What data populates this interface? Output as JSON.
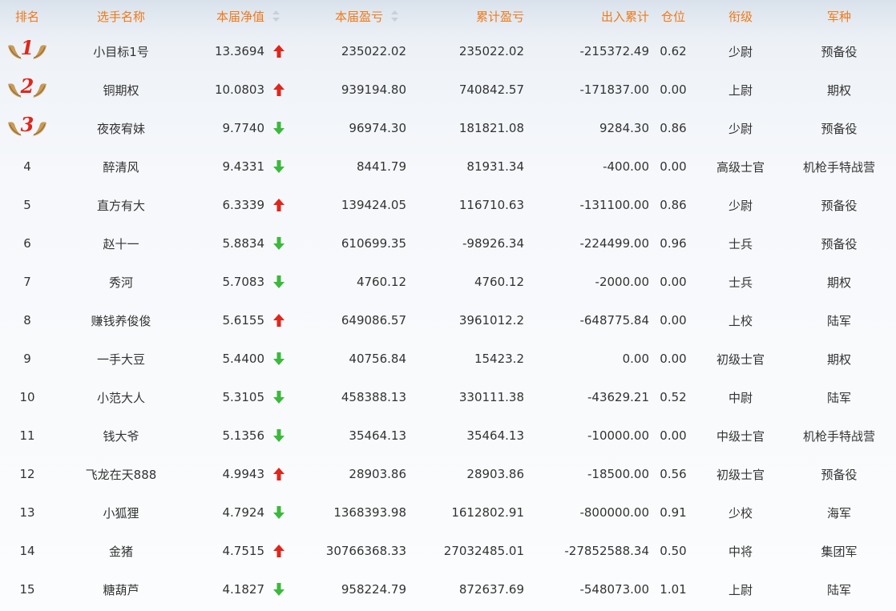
{
  "headers": {
    "rank": "排名",
    "name": "选手名称",
    "net_value": "本届净值",
    "period_pnl": "本届盈亏",
    "cumulative_pnl": "累计盈亏",
    "cash_flow": "出入累计",
    "position": "仓位",
    "military_rank": "衔级",
    "branch": "军种"
  },
  "colors": {
    "header_text": "#ee7a1a",
    "up": "#e0261b",
    "down": "#3cb93c",
    "medal_number": "#e0261b"
  },
  "rows": [
    {
      "rank": "1",
      "medal": true,
      "name": "小目标1号",
      "net_value": "13.3694",
      "trend": "up",
      "period_pnl": "235022.02",
      "cumulative_pnl": "235022.02",
      "cash_flow": "-215372.49",
      "position": "0.62",
      "military_rank": "少尉",
      "branch": "预备役"
    },
    {
      "rank": "2",
      "medal": true,
      "name": "铜期权",
      "net_value": "10.0803",
      "trend": "up",
      "period_pnl": "939194.80",
      "cumulative_pnl": "740842.57",
      "cash_flow": "-171837.00",
      "position": "0.00",
      "military_rank": "上尉",
      "branch": "期权"
    },
    {
      "rank": "3",
      "medal": true,
      "name": "夜夜宥妹",
      "net_value": "9.7740",
      "trend": "down",
      "period_pnl": "96974.30",
      "cumulative_pnl": "181821.08",
      "cash_flow": "9284.30",
      "position": "0.86",
      "military_rank": "少尉",
      "branch": "预备役"
    },
    {
      "rank": "4",
      "medal": false,
      "name": "醉清风",
      "net_value": "9.4331",
      "trend": "down",
      "period_pnl": "8441.79",
      "cumulative_pnl": "81931.34",
      "cash_flow": "-400.00",
      "position": "0.00",
      "military_rank": "高级士官",
      "branch": "机枪手特战营"
    },
    {
      "rank": "5",
      "medal": false,
      "name": "直方有大",
      "net_value": "6.3339",
      "trend": "up",
      "period_pnl": "139424.05",
      "cumulative_pnl": "116710.63",
      "cash_flow": "-131100.00",
      "position": "0.86",
      "military_rank": "少尉",
      "branch": "预备役"
    },
    {
      "rank": "6",
      "medal": false,
      "name": "赵十一",
      "net_value": "5.8834",
      "trend": "down",
      "period_pnl": "610699.35",
      "cumulative_pnl": "-98926.34",
      "cash_flow": "-224499.00",
      "position": "0.96",
      "military_rank": "士兵",
      "branch": "预备役"
    },
    {
      "rank": "7",
      "medal": false,
      "name": "秀河",
      "net_value": "5.7083",
      "trend": "down",
      "period_pnl": "4760.12",
      "cumulative_pnl": "4760.12",
      "cash_flow": "-2000.00",
      "position": "0.00",
      "military_rank": "士兵",
      "branch": "期权"
    },
    {
      "rank": "8",
      "medal": false,
      "name": "赚钱养俊俊",
      "net_value": "5.6155",
      "trend": "up",
      "period_pnl": "649086.57",
      "cumulative_pnl": "3961012.2",
      "cash_flow": "-648775.84",
      "position": "0.00",
      "military_rank": "上校",
      "branch": "陆军"
    },
    {
      "rank": "9",
      "medal": false,
      "name": "一手大豆",
      "net_value": "5.4400",
      "trend": "down",
      "period_pnl": "40756.84",
      "cumulative_pnl": "15423.2",
      "cash_flow": "0.00",
      "position": "0.00",
      "military_rank": "初级士官",
      "branch": "期权"
    },
    {
      "rank": "10",
      "medal": false,
      "name": "小范大人",
      "net_value": "5.3105",
      "trend": "down",
      "period_pnl": "458388.13",
      "cumulative_pnl": "330111.38",
      "cash_flow": "-43629.21",
      "position": "0.52",
      "military_rank": "中尉",
      "branch": "陆军"
    },
    {
      "rank": "11",
      "medal": false,
      "name": "钱大爷",
      "net_value": "5.1356",
      "trend": "down",
      "period_pnl": "35464.13",
      "cumulative_pnl": "35464.13",
      "cash_flow": "-10000.00",
      "position": "0.00",
      "military_rank": "中级士官",
      "branch": "机枪手特战营"
    },
    {
      "rank": "12",
      "medal": false,
      "name": "飞龙在天888",
      "net_value": "4.9943",
      "trend": "up",
      "period_pnl": "28903.86",
      "cumulative_pnl": "28903.86",
      "cash_flow": "-18500.00",
      "position": "0.56",
      "military_rank": "初级士官",
      "branch": "预备役"
    },
    {
      "rank": "13",
      "medal": false,
      "name": "小狐狸",
      "net_value": "4.7924",
      "trend": "down",
      "period_pnl": "1368393.98",
      "cumulative_pnl": "1612802.91",
      "cash_flow": "-800000.00",
      "position": "0.91",
      "military_rank": "少校",
      "branch": "海军"
    },
    {
      "rank": "14",
      "medal": false,
      "name": "金猪",
      "net_value": "4.7515",
      "trend": "up",
      "period_pnl": "30766368.33",
      "cumulative_pnl": "27032485.01",
      "cash_flow": "-27852588.34",
      "position": "0.50",
      "military_rank": "中将",
      "branch": "集团军"
    },
    {
      "rank": "15",
      "medal": false,
      "name": "糖葫芦",
      "net_value": "4.1827",
      "trend": "down",
      "period_pnl": "958224.79",
      "cumulative_pnl": "872637.69",
      "cash_flow": "-548073.00",
      "position": "1.01",
      "military_rank": "上尉",
      "branch": "陆军"
    }
  ]
}
